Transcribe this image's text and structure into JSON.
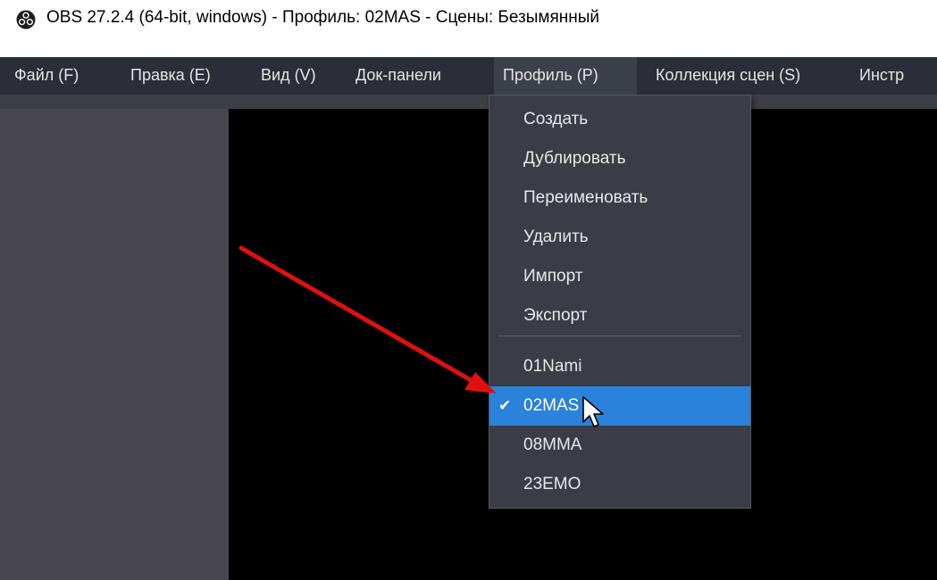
{
  "window": {
    "title": "OBS 27.2.4 (64-bit, windows) - Профиль: 02MAS - Сцены: Безымянный",
    "icon": "obs-logo-icon"
  },
  "menubar": {
    "items": [
      {
        "label": "Файл (F)"
      },
      {
        "label": "Правка (E)"
      },
      {
        "label": "Вид (V)"
      },
      {
        "label": "Док-панели"
      },
      {
        "label": "Профиль (P)"
      },
      {
        "label": "Коллекция сцен (S)"
      },
      {
        "label": "Инстр"
      }
    ]
  },
  "profile_menu": {
    "actions": [
      {
        "label": "Создать"
      },
      {
        "label": "Дублировать"
      },
      {
        "label": "Переименовать"
      },
      {
        "label": "Удалить"
      },
      {
        "label": "Импорт"
      },
      {
        "label": "Экспорт"
      }
    ],
    "profiles": [
      {
        "label": "01Nami",
        "checked": false
      },
      {
        "label": "02MAS",
        "checked": true
      },
      {
        "label": "08MMA",
        "checked": false
      },
      {
        "label": "23EMO",
        "checked": false
      }
    ],
    "check_mark": "✔"
  },
  "colors": {
    "menubar_bg": "#2b2e38",
    "dropdown_bg": "#3a3d46",
    "selection": "#2a82da",
    "annotation_arrow": "#e01010"
  }
}
